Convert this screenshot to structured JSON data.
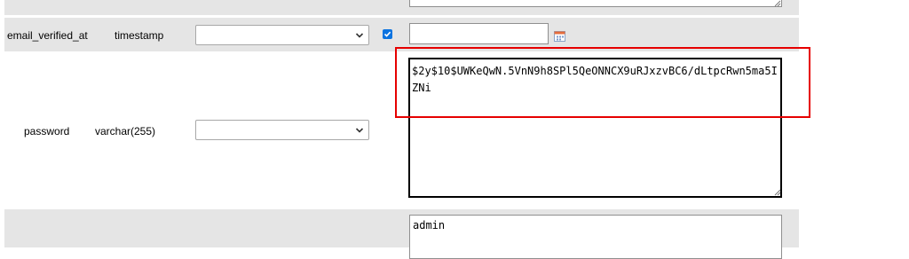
{
  "rows": [
    {
      "field": "",
      "type": "",
      "function": "",
      "value": ""
    },
    {
      "field": "email_verified_at",
      "type": "timestamp",
      "function": "",
      "null_checked": true,
      "value": ""
    },
    {
      "field": "password",
      "type": "varchar(255)",
      "function": "",
      "value": "$2y$10$UWKeQwN.5VnN9h8SPl5QeONNCX9uRJxzvBC6/dLtpcRwn5ma5IZNi"
    },
    {
      "field": "",
      "type": "",
      "function": "",
      "value": "admin"
    }
  ],
  "icons": {
    "calendar": "calendar-icon",
    "dropdown": "chevron-down-icon",
    "checkbox": "checkmark-icon",
    "resize": "resize-grip-icon"
  },
  "colors": {
    "row_gray": "#e5e5e5",
    "checkbox_blue": "#0b73e0",
    "highlight_red": "#e60000"
  }
}
